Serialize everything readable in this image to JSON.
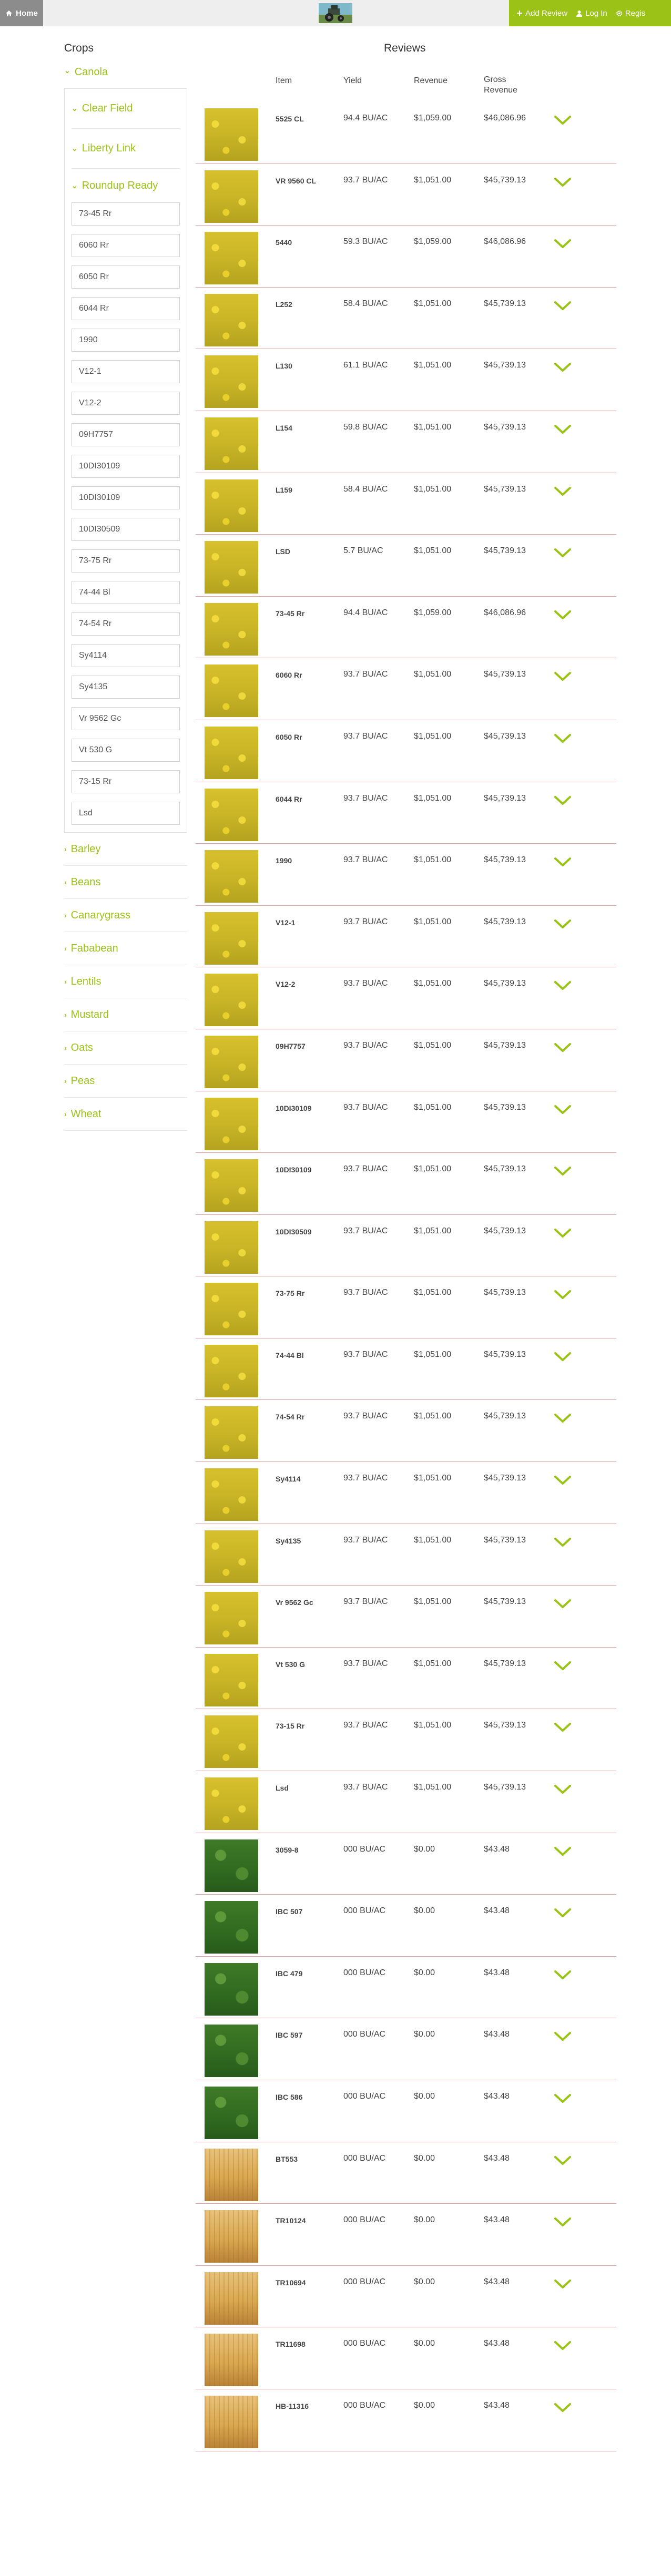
{
  "topbar": {
    "home_label": "Home",
    "logo": "tractor-logo",
    "actions": [
      {
        "label": "Add Review",
        "icon": "plus-icon"
      },
      {
        "label": "Log In",
        "icon": "user-icon"
      },
      {
        "label": "Regis",
        "icon": "gear-icon"
      }
    ]
  },
  "sidebar": {
    "heading": "Crops",
    "open_crop": "Canola",
    "sub_groups": [
      {
        "label": "Clear Field",
        "open": false
      },
      {
        "label": "Liberty Link",
        "open": false
      },
      {
        "label": "Roundup Ready",
        "open": true
      }
    ],
    "varieties": [
      "73-45 Rr",
      "6060 Rr",
      "6050 Rr",
      "6044 Rr",
      "1990",
      "V12-1",
      "V12-2",
      "09H7757",
      "10DI30109",
      "10DI30109",
      "10DI30509",
      "73-75 Rr",
      "74-44 Bl",
      "74-54 Rr",
      "Sy4114",
      "Sy4135",
      "Vr 9562 Gc",
      "Vt 530 G",
      "73-15 Rr",
      "Lsd"
    ],
    "other_crops": [
      "Barley",
      "Beans",
      "Canarygrass",
      "Fababean",
      "Lentils",
      "Mustard",
      "Oats",
      "Peas",
      "Wheat"
    ]
  },
  "reviews": {
    "heading": "Reviews",
    "columns": {
      "item": "Item",
      "yield": "Yield",
      "revenue": "Revenue",
      "gross": "Gross\nRevenue"
    },
    "rows": [
      {
        "name": "5525 CL",
        "yield": "94.4 BU/AC",
        "revenue": "$1,059.00",
        "gross": "$46,086.96",
        "image": "canola"
      },
      {
        "name": "VR 9560 CL",
        "yield": "93.7 BU/AC",
        "revenue": "$1,051.00",
        "gross": "$45,739.13",
        "image": "canola"
      },
      {
        "name": "5440",
        "yield": "59.3 BU/AC",
        "revenue": "$1,059.00",
        "gross": "$46,086.96",
        "image": "canola"
      },
      {
        "name": "L252",
        "yield": "58.4 BU/AC",
        "revenue": "$1,051.00",
        "gross": "$45,739.13",
        "image": "canola"
      },
      {
        "name": "L130",
        "yield": "61.1 BU/AC",
        "revenue": "$1,051.00",
        "gross": "$45,739.13",
        "image": "canola"
      },
      {
        "name": "L154",
        "yield": "59.8 BU/AC",
        "revenue": "$1,051.00",
        "gross": "$45,739.13",
        "image": "canola"
      },
      {
        "name": "L159",
        "yield": "58.4 BU/AC",
        "revenue": "$1,051.00",
        "gross": "$45,739.13",
        "image": "canola"
      },
      {
        "name": "LSD",
        "yield": "5.7 BU/AC",
        "revenue": "$1,051.00",
        "gross": "$45,739.13",
        "image": "canola"
      },
      {
        "name": "73-45 Rr",
        "yield": "94.4 BU/AC",
        "revenue": "$1,059.00",
        "gross": "$46,086.96",
        "image": "canola"
      },
      {
        "name": "6060 Rr",
        "yield": "93.7 BU/AC",
        "revenue": "$1,051.00",
        "gross": "$45,739.13",
        "image": "canola"
      },
      {
        "name": "6050 Rr",
        "yield": "93.7 BU/AC",
        "revenue": "$1,051.00",
        "gross": "$45,739.13",
        "image": "canola"
      },
      {
        "name": "6044 Rr",
        "yield": "93.7 BU/AC",
        "revenue": "$1,051.00",
        "gross": "$45,739.13",
        "image": "canola"
      },
      {
        "name": "1990",
        "yield": "93.7 BU/AC",
        "revenue": "$1,051.00",
        "gross": "$45,739.13",
        "image": "canola"
      },
      {
        "name": "V12-1",
        "yield": "93.7 BU/AC",
        "revenue": "$1,051.00",
        "gross": "$45,739.13",
        "image": "canola"
      },
      {
        "name": "V12-2",
        "yield": "93.7 BU/AC",
        "revenue": "$1,051.00",
        "gross": "$45,739.13",
        "image": "canola"
      },
      {
        "name": "09H7757",
        "yield": "93.7 BU/AC",
        "revenue": "$1,051.00",
        "gross": "$45,739.13",
        "image": "canola"
      },
      {
        "name": "10DI30109",
        "yield": "93.7 BU/AC",
        "revenue": "$1,051.00",
        "gross": "$45,739.13",
        "image": "canola"
      },
      {
        "name": "10DI30109",
        "yield": "93.7 BU/AC",
        "revenue": "$1,051.00",
        "gross": "$45,739.13",
        "image": "canola"
      },
      {
        "name": "10DI30509",
        "yield": "93.7 BU/AC",
        "revenue": "$1,051.00",
        "gross": "$45,739.13",
        "image": "canola"
      },
      {
        "name": "73-75 Rr",
        "yield": "93.7 BU/AC",
        "revenue": "$1,051.00",
        "gross": "$45,739.13",
        "image": "canola"
      },
      {
        "name": "74-44 Bl",
        "yield": "93.7 BU/AC",
        "revenue": "$1,051.00",
        "gross": "$45,739.13",
        "image": "canola"
      },
      {
        "name": "74-54 Rr",
        "yield": "93.7 BU/AC",
        "revenue": "$1,051.00",
        "gross": "$45,739.13",
        "image": "canola"
      },
      {
        "name": "Sy4114",
        "yield": "93.7 BU/AC",
        "revenue": "$1,051.00",
        "gross": "$45,739.13",
        "image": "canola"
      },
      {
        "name": "Sy4135",
        "yield": "93.7 BU/AC",
        "revenue": "$1,051.00",
        "gross": "$45,739.13",
        "image": "canola"
      },
      {
        "name": "Vr 9562 Gc",
        "yield": "93.7 BU/AC",
        "revenue": "$1,051.00",
        "gross": "$45,739.13",
        "image": "canola"
      },
      {
        "name": "Vt 530 G",
        "yield": "93.7 BU/AC",
        "revenue": "$1,051.00",
        "gross": "$45,739.13",
        "image": "canola"
      },
      {
        "name": "73-15 Rr",
        "yield": "93.7 BU/AC",
        "revenue": "$1,051.00",
        "gross": "$45,739.13",
        "image": "canola"
      },
      {
        "name": "Lsd",
        "yield": "93.7 BU/AC",
        "revenue": "$1,051.00",
        "gross": "$45,739.13",
        "image": "canola"
      },
      {
        "name": "3059-8",
        "yield": "000 BU/AC",
        "revenue": "$0.00",
        "gross": "$43.48",
        "image": "soy"
      },
      {
        "name": "IBC 507",
        "yield": "000 BU/AC",
        "revenue": "$0.00",
        "gross": "$43.48",
        "image": "soy"
      },
      {
        "name": "IBC 479",
        "yield": "000 BU/AC",
        "revenue": "$0.00",
        "gross": "$43.48",
        "image": "soy"
      },
      {
        "name": "IBC 597",
        "yield": "000 BU/AC",
        "revenue": "$0.00",
        "gross": "$43.48",
        "image": "soy"
      },
      {
        "name": "IBC 586",
        "yield": "000 BU/AC",
        "revenue": "$0.00",
        "gross": "$43.48",
        "image": "soy"
      },
      {
        "name": "BT553",
        "yield": "000 BU/AC",
        "revenue": "$0.00",
        "gross": "$43.48",
        "image": "wheat"
      },
      {
        "name": "TR10124",
        "yield": "000 BU/AC",
        "revenue": "$0.00",
        "gross": "$43.48",
        "image": "wheat"
      },
      {
        "name": "TR10694",
        "yield": "000 BU/AC",
        "revenue": "$0.00",
        "gross": "$43.48",
        "image": "wheat"
      },
      {
        "name": "TR11698",
        "yield": "000 BU/AC",
        "revenue": "$0.00",
        "gross": "$43.48",
        "image": "wheat"
      },
      {
        "name": "HB-11316",
        "yield": "000 BU/AC",
        "revenue": "$0.00",
        "gross": "$43.48",
        "image": "wheat"
      }
    ]
  },
  "colors": {
    "accent": "#9bc317",
    "row_border": "#e4a0a0",
    "topbar": "#eeeeee",
    "home": "#8c8c8c"
  }
}
